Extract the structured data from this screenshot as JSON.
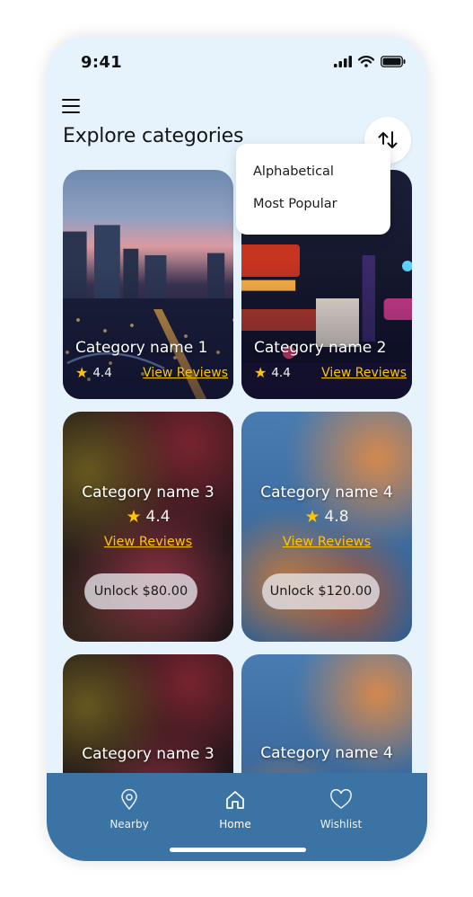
{
  "status_bar": {
    "time": "9:41"
  },
  "header": {
    "title": "Explore categories"
  },
  "sort_menu": {
    "options": [
      "Alphabetical",
      "Most Popular"
    ]
  },
  "cards": [
    {
      "title": "Category name 1",
      "rating": "4.4",
      "reviews_label": "View Reviews",
      "locked": false
    },
    {
      "title": "Category name 2",
      "rating": "4.4",
      "reviews_label": "View Reviews",
      "locked": false
    },
    {
      "title": "Category name 3",
      "rating": "4.4",
      "reviews_label": "View Reviews",
      "locked": true,
      "unlock_label": "Unlock $80.00"
    },
    {
      "title": "Category name 4",
      "rating": "4.8",
      "reviews_label": "View Reviews",
      "locked": true,
      "unlock_label": "Unlock $120.00"
    },
    {
      "title": "Category name 3",
      "locked": true
    },
    {
      "title": "Category name 4",
      "locked": true
    }
  ],
  "bottom_nav": {
    "items": [
      {
        "label": "Nearby",
        "icon": "location-pin-icon"
      },
      {
        "label": "Home",
        "icon": "home-icon"
      },
      {
        "label": "Wishlist",
        "icon": "heart-icon"
      }
    ]
  },
  "colors": {
    "background": "#e6f3fd",
    "nav": "#3c73a5",
    "accent": "#ffc400"
  }
}
